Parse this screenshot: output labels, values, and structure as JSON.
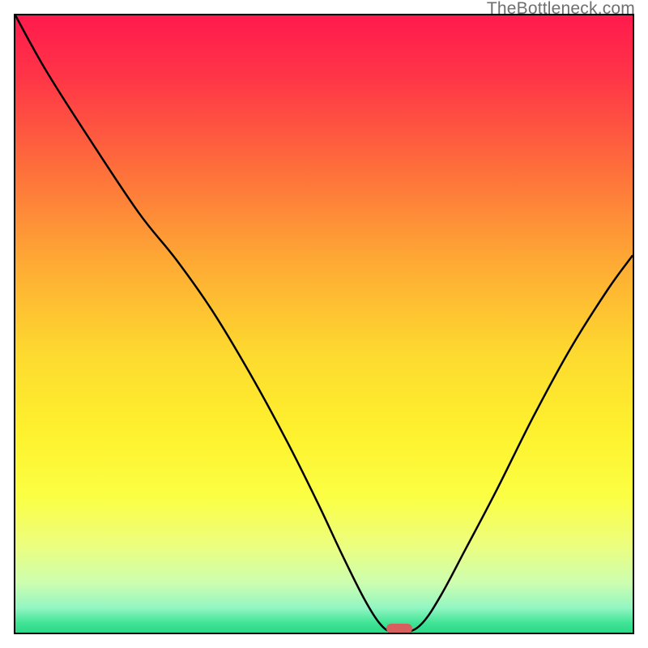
{
  "watermark": {
    "text": "TheBottleneck.com"
  },
  "chart_data": {
    "type": "line",
    "title": "",
    "xlabel": "",
    "ylabel": "",
    "xlim": [
      0,
      100
    ],
    "ylim": [
      0,
      100
    ],
    "grid": false,
    "legend": false,
    "background": {
      "type": "vertical-gradient",
      "stops": [
        {
          "pos": 0.0,
          "color": "#ff1a4d"
        },
        {
          "pos": 0.1,
          "color": "#ff3547"
        },
        {
          "pos": 0.25,
          "color": "#fe6f3b"
        },
        {
          "pos": 0.4,
          "color": "#feaa34"
        },
        {
          "pos": 0.55,
          "color": "#fdda2f"
        },
        {
          "pos": 0.68,
          "color": "#fef22e"
        },
        {
          "pos": 0.78,
          "color": "#fbff44"
        },
        {
          "pos": 0.86,
          "color": "#ecfe7f"
        },
        {
          "pos": 0.92,
          "color": "#ccfeb0"
        },
        {
          "pos": 0.96,
          "color": "#92f6c2"
        },
        {
          "pos": 0.985,
          "color": "#3fe394"
        },
        {
          "pos": 1.0,
          "color": "#2bd988"
        }
      ]
    },
    "series": [
      {
        "name": "bottleneck-curve",
        "color": "#000000",
        "x": [
          0.0,
          5.0,
          12.0,
          20.0,
          26.0,
          32.0,
          38.0,
          44.0,
          49.0,
          53.0,
          56.5,
          59.0,
          61.0,
          63.5,
          66.0,
          69.0,
          73.0,
          78.0,
          84.0,
          90.0,
          96.0,
          100.0
        ],
        "y": [
          100.0,
          91.0,
          80.0,
          68.0,
          60.5,
          52.0,
          42.0,
          31.0,
          21.0,
          12.5,
          5.5,
          1.5,
          0.0,
          0.0,
          1.5,
          6.0,
          13.5,
          23.0,
          35.0,
          46.0,
          55.5,
          61.0
        ]
      }
    ],
    "annotations": [
      {
        "name": "optimal-marker",
        "shape": "capsule",
        "color": "#d7605f",
        "x": 62.3,
        "y": 0.6,
        "width_pct": 4.2,
        "height_pct": 1.5
      }
    ]
  }
}
